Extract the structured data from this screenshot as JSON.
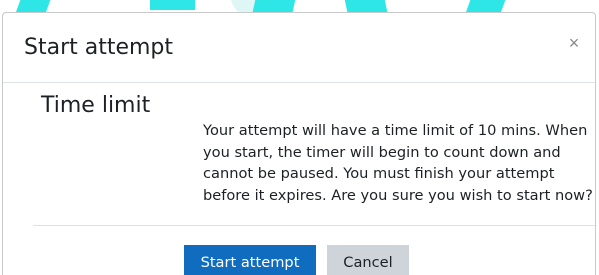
{
  "dialog": {
    "title": "Start attempt",
    "close_glyph": "×",
    "close_icon": "close-icon"
  },
  "content": {
    "heading": "Time limit",
    "message": "Your attempt will have a time limit of 10 mins. When you start, the timer will begin to count down and cannot be paused. You must finish your attempt before it expires. Are you sure you wish to start now?"
  },
  "actions": {
    "start_label": "Start attempt",
    "cancel_label": "Cancel"
  },
  "colors": {
    "primary": "#0f6cbf",
    "secondary": "#ced4da",
    "background_accent": "#2ee6e6"
  }
}
